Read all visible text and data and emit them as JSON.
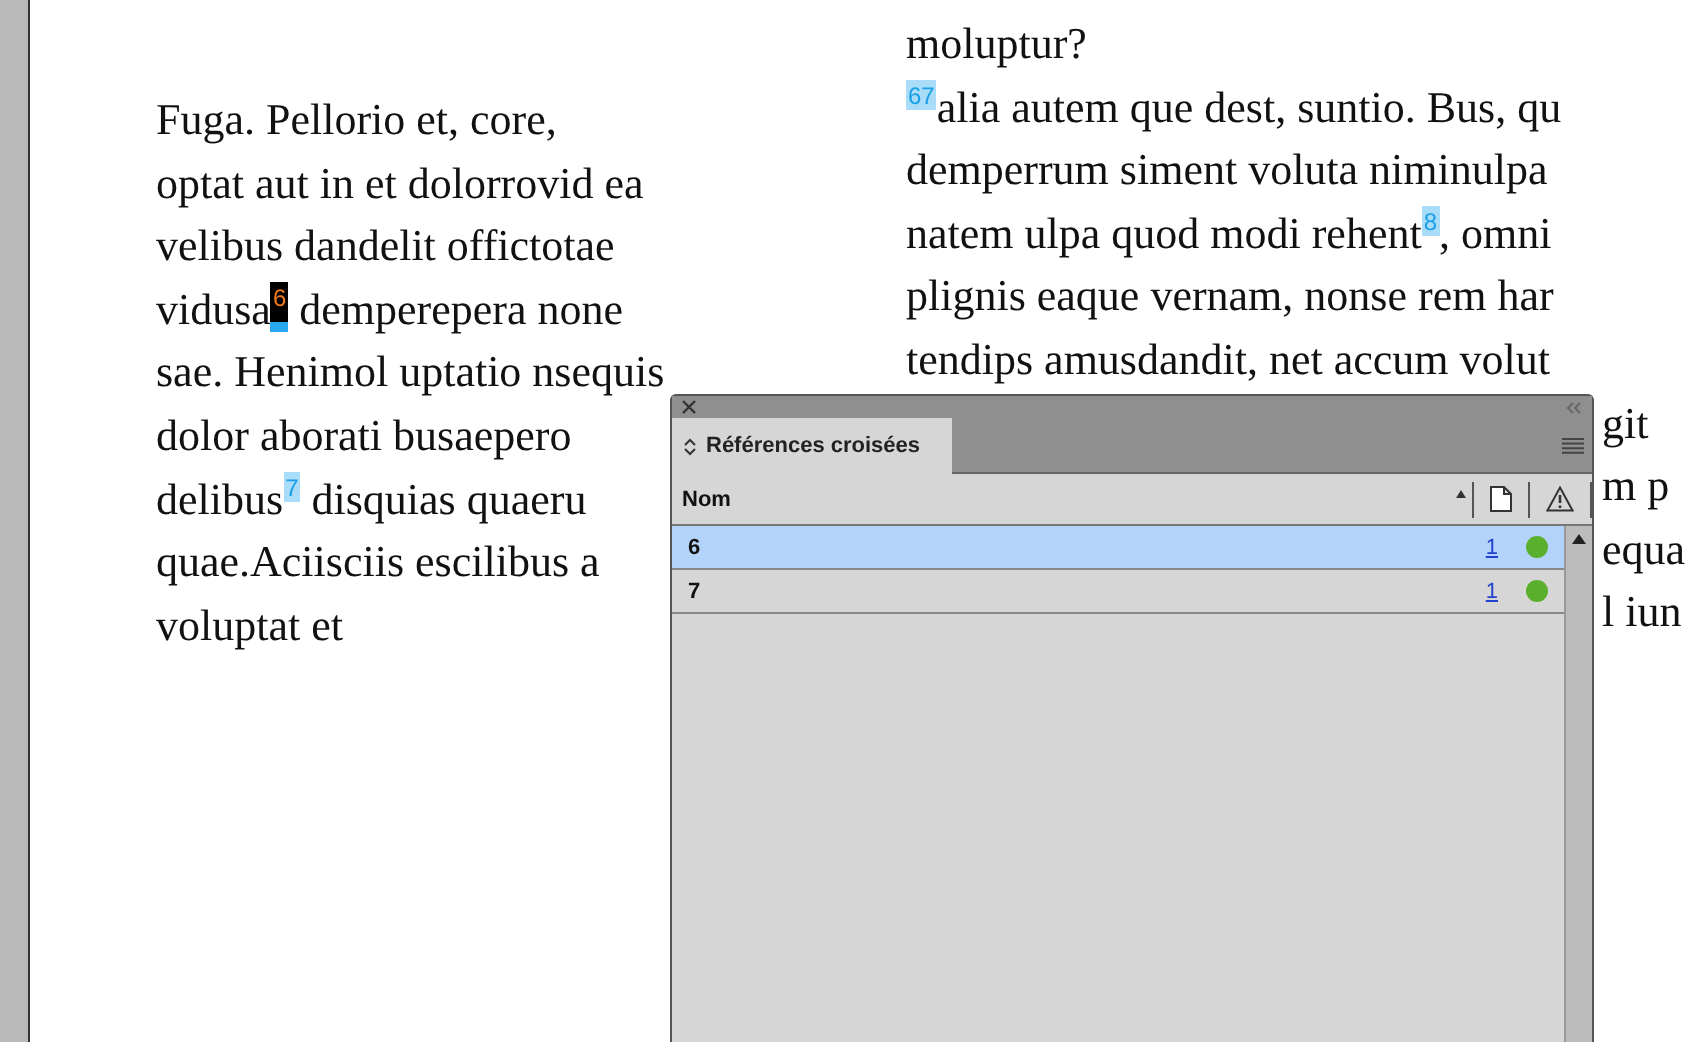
{
  "left_column": {
    "lines": [
      [
        {
          "kind": "text",
          "text": "Fuga. Pellorio et, core,"
        }
      ],
      [
        {
          "kind": "text",
          "text": "optat aut in et dolorrovid ea"
        }
      ],
      [
        {
          "kind": "text",
          "text": "velibus dandelit offictotae"
        }
      ],
      [
        {
          "kind": "text",
          "text": "vidusa"
        },
        {
          "kind": "marker",
          "text": "6",
          "selected": true
        },
        {
          "kind": "text",
          "text": " demperepera none"
        }
      ],
      [
        {
          "kind": "text",
          "text": "sae. Henimol uptatio nsequis"
        }
      ],
      [
        {
          "kind": "text",
          "text": "dolor aborati busaepero"
        }
      ],
      [
        {
          "kind": "text",
          "text": "delibus"
        },
        {
          "kind": "marker",
          "text": "7",
          "selected": false
        },
        {
          "kind": "text",
          "text": " disquias quaeru"
        }
      ],
      [
        {
          "kind": "text",
          "text": "quae.Aciisciis escilibus a"
        }
      ],
      [
        {
          "kind": "text",
          "text": "voluptat et"
        }
      ]
    ]
  },
  "right_column": {
    "lines": [
      {
        "kind": "line",
        "parts": [
          {
            "kind": "text",
            "text": "moluptur?"
          }
        ]
      },
      {
        "kind": "line",
        "parts": [
          {
            "kind": "marker",
            "text": "67",
            "selected": false
          },
          {
            "kind": "text",
            "text": "alia autem que dest, suntio. Bus, qu"
          }
        ]
      },
      {
        "kind": "line",
        "parts": [
          {
            "kind": "text",
            "text": "demperrum siment voluta niminulpa"
          }
        ]
      },
      {
        "kind": "line",
        "parts": [
          {
            "kind": "text",
            "text": "natem ulpa quod modi rehent"
          },
          {
            "kind": "marker",
            "text": "8",
            "selected": false
          },
          {
            "kind": "text",
            "text": ", omni"
          }
        ]
      },
      {
        "kind": "line",
        "parts": [
          {
            "kind": "text",
            "text": "plignis eaque vernam, nonse rem har"
          }
        ]
      },
      {
        "kind": "line",
        "parts": [
          {
            "kind": "text",
            "text": "tendips amusdandit, net accum volut"
          }
        ]
      },
      {
        "kind": "fragment",
        "parts": [
          {
            "kind": "text",
            "text": "git"
          }
        ]
      },
      {
        "kind": "fragment",
        "parts": [
          {
            "kind": "text",
            "text": "m p"
          }
        ]
      },
      {
        "kind": "fragment",
        "parts": [
          {
            "kind": "text",
            "text": "equa"
          }
        ]
      },
      {
        "kind": "fragment",
        "parts": [
          {
            "kind": "text",
            "text": "l iun"
          }
        ]
      }
    ]
  },
  "panel": {
    "tab": "Références croisées",
    "column": "Nom",
    "rows": [
      {
        "name": "6",
        "page": "1",
        "selected": true,
        "color": "#5ab02c"
      },
      {
        "name": "7",
        "page": "1",
        "selected": false,
        "color": "#5ab02c"
      }
    ]
  }
}
